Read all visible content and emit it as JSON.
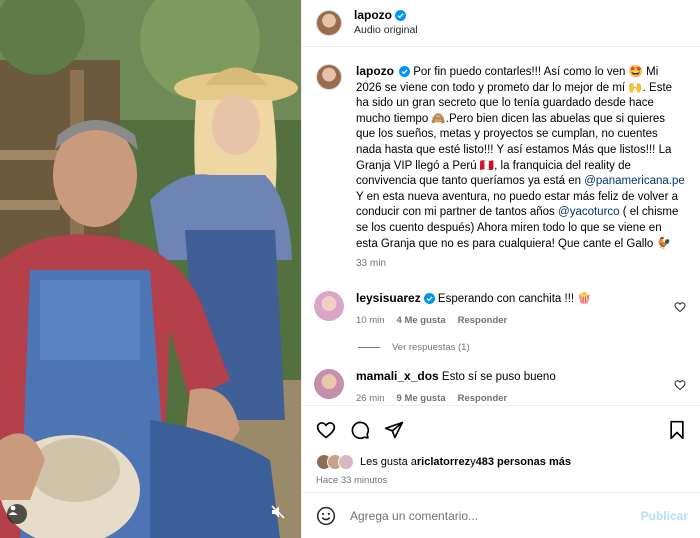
{
  "post": {
    "username": "lapozo",
    "audio": "Audio original",
    "caption_user": "lapozo",
    "caption_before_link": "Por fin puedo contarles!!! Así como lo ven 🤩 Mi 2026 se viene con todo y prometo dar lo mejor de mí 🙌. Este ha sido un gran secreto que lo tenía guardado desde hace mucho tiempo 🙈.Pero bien dicen las abuelas que si quieres que los sueños, metas y proyectos se cumplan, no cuentes nada hasta que esté listo!!! Y así estamos Más que listos!!! La Granja VIP llegó a Perú 🇵🇪, la franquicia del reality de convivencia que tanto queríamos ya está en ",
    "caption_link1": "@panamericana.pe",
    "caption_middle": "Y en esta nueva aventura, no puedo estar más feliz de volver a conducir con mi partner de tantos años ",
    "caption_link2": "@yacoturco",
    "caption_after": " ( el chisme se los cuento después) Ahora miren todo lo que se viene en esta Granja que no es para cualquiera! Que cante el Gallo 🐓",
    "time": "33 min"
  },
  "comments": [
    {
      "user": "leysisuarez",
      "text": "Esperando con canchita !!! 🍿",
      "time": "10 min",
      "likes": "4 Me gusta",
      "reply": "Responder"
    },
    {
      "user": "mamali_x_dos",
      "text": "Esto sí se puso bueno",
      "time": "26 min",
      "likes": "9 Me gusta",
      "reply": "Responder"
    }
  ],
  "replies_label": "Ver respuestas (1)",
  "likes_line": {
    "prefix": "Les gusta a ",
    "user": "riclatorrez",
    "middle": " y ",
    "count": "483 personas más"
  },
  "posted_ago": "Hace 33 minutos",
  "composer": {
    "placeholder": "Agrega un comentario...",
    "publish": "Publicar"
  },
  "icons": {
    "like": "heart-icon",
    "comment": "comment-icon",
    "share": "share-icon",
    "save": "bookmark-icon",
    "emoji": "emoji-icon",
    "mute": "muted-speaker-icon",
    "tagged": "user-icon",
    "verified": "verified-badge-icon"
  },
  "colors": {
    "verified": "#0095f6",
    "link": "#00376b",
    "muted": "#737373",
    "publish": "#b2dffc"
  }
}
